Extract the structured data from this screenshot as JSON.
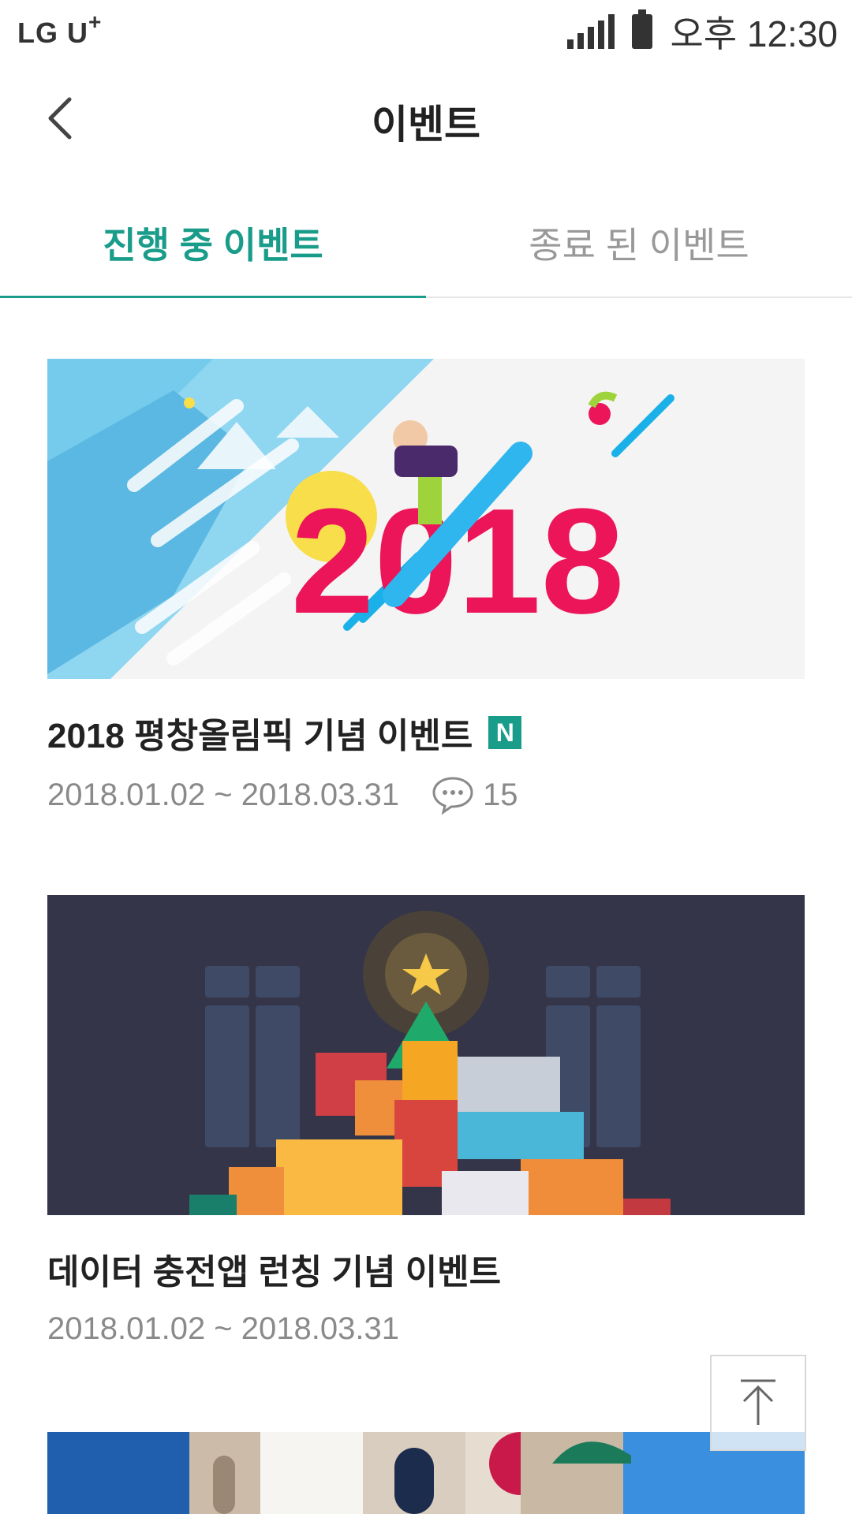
{
  "status_bar": {
    "carrier": "LG U",
    "carrier_sup": "+",
    "time": "오후 12:30"
  },
  "header": {
    "title": "이벤트",
    "back_icon": "chevron-left-icon"
  },
  "tabs": [
    {
      "label": "진행 중 이벤트",
      "active": true
    },
    {
      "label": "종료 된 이벤트",
      "active": false
    }
  ],
  "events": [
    {
      "title": "2018 평창올림픽 기념 이벤트",
      "badge": "N",
      "dates": "2018.01.02 ~ 2018.03.31",
      "comments": "15",
      "banner_text": "2018"
    },
    {
      "title": "데이터 충전앱 런칭 기념 이벤트",
      "dates": "2018.01.02 ~ 2018.03.31"
    }
  ],
  "colors": {
    "accent": "#1a9c8a",
    "banner1_red": "#ec1559",
    "banner2_bg": "#343548"
  },
  "scroll_top_icon": "arrow-up-icon"
}
